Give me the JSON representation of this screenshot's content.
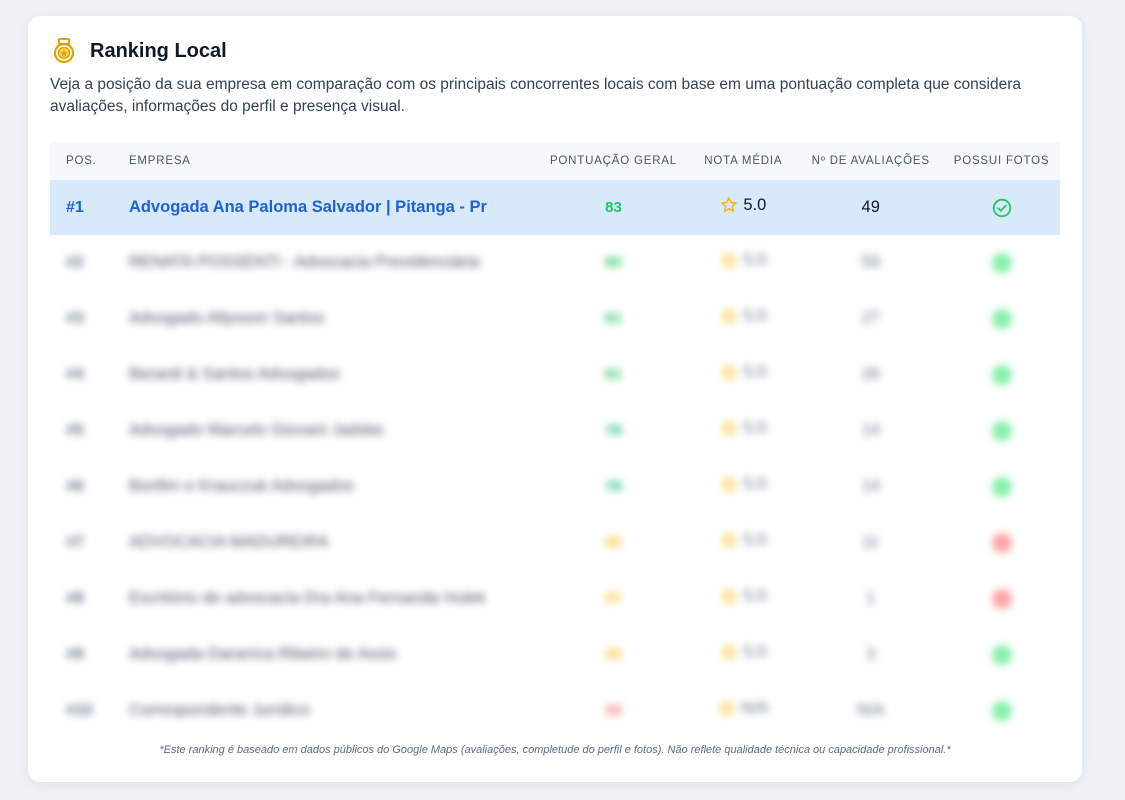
{
  "header": {
    "title": "Ranking Local",
    "description": "Veja a posição da sua empresa em comparação com os principais concorrentes locais com base em uma pontuação completa que considera avaliações, informações do perfil e presença visual."
  },
  "table": {
    "columns": {
      "pos": "Pos.",
      "empresa": "Empresa",
      "pontuacao": "Pontuação Geral",
      "nota": "Nota Média",
      "avaliacoes": "Nº de Avaliações",
      "fotos": "Possui Fotos"
    },
    "rows": [
      {
        "pos": "#1",
        "empresa": "Advogada Ana Paloma Salvador | Pitanga - Pr",
        "score": "83",
        "nota": "5.0",
        "avaliacoes": "49",
        "fotos": "check",
        "score_color": "#22c55e",
        "highlighted": true
      },
      {
        "pos": "#2",
        "empresa": "RENATA POSSENTI - Advocacia Previdenciária",
        "score": "80",
        "nota": "5.0",
        "avaliacoes": "59",
        "fotos": "yes",
        "score_color": "#22c55e"
      },
      {
        "pos": "#3",
        "empresa": "Advogado Allysson Santos",
        "score": "81",
        "nota": "5.0",
        "avaliacoes": "27",
        "fotos": "yes",
        "score_color": "#22c55e"
      },
      {
        "pos": "#4",
        "empresa": "Berardi & Santos Advogados",
        "score": "81",
        "nota": "5.0",
        "avaliacoes": "26",
        "fotos": "yes",
        "score_color": "#22c55e"
      },
      {
        "pos": "#5",
        "empresa": "Advogado Marcelo Giovani Jadske",
        "score": "78",
        "nota": "5.0",
        "avaliacoes": "14",
        "fotos": "yes",
        "score_color": "#10b981"
      },
      {
        "pos": "#6",
        "empresa": "Bonfim e Krauczuk Advogados",
        "score": "78",
        "nota": "5.0",
        "avaliacoes": "14",
        "fotos": "yes",
        "score_color": "#10b981"
      },
      {
        "pos": "#7",
        "empresa": "ADVOCACIA MADUREIRA",
        "score": "60",
        "nota": "5.0",
        "avaliacoes": "11",
        "fotos": "no",
        "score_color": "#fbbf24"
      },
      {
        "pos": "#8",
        "empresa": "Escritório de advocacia Dra Ana Fernanda Hulek",
        "score": "57",
        "nota": "5.0",
        "avaliacoes": "1",
        "fotos": "no",
        "score_color": "#fbbf24"
      },
      {
        "pos": "#9",
        "empresa": "Advogada Danerica Ribeiro de Assis",
        "score": "55",
        "nota": "5.0",
        "avaliacoes": "3",
        "fotos": "yes",
        "score_color": "#fbbf24"
      },
      {
        "pos": "#10",
        "empresa": "Correspondente Jurídico",
        "score": "30",
        "nota": "N/A",
        "avaliacoes": "N/A",
        "fotos": "yes",
        "score_color": "#f87171"
      }
    ]
  },
  "footnote": "*Este ranking é baseado em dados públicos do Google Maps (avaliações, completude do perfil e fotos). Não reflete qualidade técnica ou capacidade profissional.*",
  "icons": {
    "title_icon": "medal-icon",
    "rating_icon": "star-icon",
    "photos_icon": "check-circle-icon"
  },
  "colors": {
    "accent": "#1f62d6",
    "highlight_row": "#d7e9fb",
    "star": "#fbbf24",
    "check": "#22c55e"
  }
}
